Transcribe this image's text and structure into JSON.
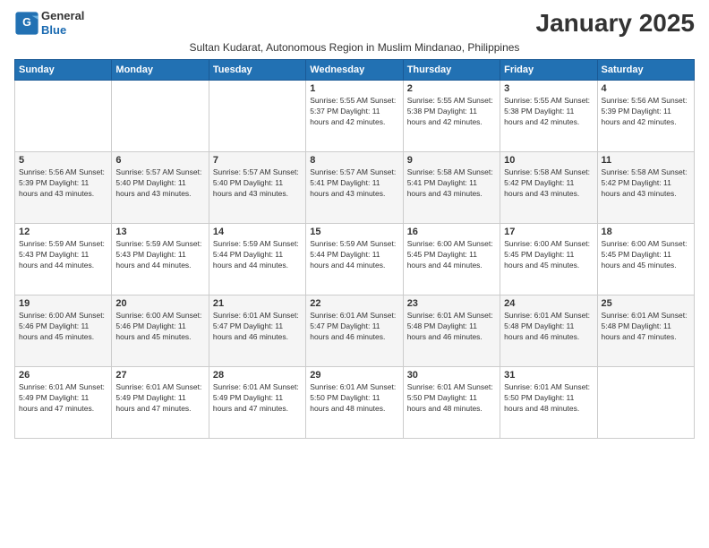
{
  "logo": {
    "line1": "General",
    "line2": "Blue"
  },
  "title": "January 2025",
  "subtitle": "Sultan Kudarat, Autonomous Region in Muslim Mindanao, Philippines",
  "days_header": [
    "Sunday",
    "Monday",
    "Tuesday",
    "Wednesday",
    "Thursday",
    "Friday",
    "Saturday"
  ],
  "weeks": [
    [
      {
        "num": "",
        "info": ""
      },
      {
        "num": "",
        "info": ""
      },
      {
        "num": "",
        "info": ""
      },
      {
        "num": "1",
        "info": "Sunrise: 5:55 AM\nSunset: 5:37 PM\nDaylight: 11 hours\nand 42 minutes."
      },
      {
        "num": "2",
        "info": "Sunrise: 5:55 AM\nSunset: 5:38 PM\nDaylight: 11 hours\nand 42 minutes."
      },
      {
        "num": "3",
        "info": "Sunrise: 5:55 AM\nSunset: 5:38 PM\nDaylight: 11 hours\nand 42 minutes."
      },
      {
        "num": "4",
        "info": "Sunrise: 5:56 AM\nSunset: 5:39 PM\nDaylight: 11 hours\nand 42 minutes."
      }
    ],
    [
      {
        "num": "5",
        "info": "Sunrise: 5:56 AM\nSunset: 5:39 PM\nDaylight: 11 hours\nand 43 minutes."
      },
      {
        "num": "6",
        "info": "Sunrise: 5:57 AM\nSunset: 5:40 PM\nDaylight: 11 hours\nand 43 minutes."
      },
      {
        "num": "7",
        "info": "Sunrise: 5:57 AM\nSunset: 5:40 PM\nDaylight: 11 hours\nand 43 minutes."
      },
      {
        "num": "8",
        "info": "Sunrise: 5:57 AM\nSunset: 5:41 PM\nDaylight: 11 hours\nand 43 minutes."
      },
      {
        "num": "9",
        "info": "Sunrise: 5:58 AM\nSunset: 5:41 PM\nDaylight: 11 hours\nand 43 minutes."
      },
      {
        "num": "10",
        "info": "Sunrise: 5:58 AM\nSunset: 5:42 PM\nDaylight: 11 hours\nand 43 minutes."
      },
      {
        "num": "11",
        "info": "Sunrise: 5:58 AM\nSunset: 5:42 PM\nDaylight: 11 hours\nand 43 minutes."
      }
    ],
    [
      {
        "num": "12",
        "info": "Sunrise: 5:59 AM\nSunset: 5:43 PM\nDaylight: 11 hours\nand 44 minutes."
      },
      {
        "num": "13",
        "info": "Sunrise: 5:59 AM\nSunset: 5:43 PM\nDaylight: 11 hours\nand 44 minutes."
      },
      {
        "num": "14",
        "info": "Sunrise: 5:59 AM\nSunset: 5:44 PM\nDaylight: 11 hours\nand 44 minutes."
      },
      {
        "num": "15",
        "info": "Sunrise: 5:59 AM\nSunset: 5:44 PM\nDaylight: 11 hours\nand 44 minutes."
      },
      {
        "num": "16",
        "info": "Sunrise: 6:00 AM\nSunset: 5:45 PM\nDaylight: 11 hours\nand 44 minutes."
      },
      {
        "num": "17",
        "info": "Sunrise: 6:00 AM\nSunset: 5:45 PM\nDaylight: 11 hours\nand 45 minutes."
      },
      {
        "num": "18",
        "info": "Sunrise: 6:00 AM\nSunset: 5:45 PM\nDaylight: 11 hours\nand 45 minutes."
      }
    ],
    [
      {
        "num": "19",
        "info": "Sunrise: 6:00 AM\nSunset: 5:46 PM\nDaylight: 11 hours\nand 45 minutes."
      },
      {
        "num": "20",
        "info": "Sunrise: 6:00 AM\nSunset: 5:46 PM\nDaylight: 11 hours\nand 45 minutes."
      },
      {
        "num": "21",
        "info": "Sunrise: 6:01 AM\nSunset: 5:47 PM\nDaylight: 11 hours\nand 46 minutes."
      },
      {
        "num": "22",
        "info": "Sunrise: 6:01 AM\nSunset: 5:47 PM\nDaylight: 11 hours\nand 46 minutes."
      },
      {
        "num": "23",
        "info": "Sunrise: 6:01 AM\nSunset: 5:48 PM\nDaylight: 11 hours\nand 46 minutes."
      },
      {
        "num": "24",
        "info": "Sunrise: 6:01 AM\nSunset: 5:48 PM\nDaylight: 11 hours\nand 46 minutes."
      },
      {
        "num": "25",
        "info": "Sunrise: 6:01 AM\nSunset: 5:48 PM\nDaylight: 11 hours\nand 47 minutes."
      }
    ],
    [
      {
        "num": "26",
        "info": "Sunrise: 6:01 AM\nSunset: 5:49 PM\nDaylight: 11 hours\nand 47 minutes."
      },
      {
        "num": "27",
        "info": "Sunrise: 6:01 AM\nSunset: 5:49 PM\nDaylight: 11 hours\nand 47 minutes."
      },
      {
        "num": "28",
        "info": "Sunrise: 6:01 AM\nSunset: 5:49 PM\nDaylight: 11 hours\nand 47 minutes."
      },
      {
        "num": "29",
        "info": "Sunrise: 6:01 AM\nSunset: 5:50 PM\nDaylight: 11 hours\nand 48 minutes."
      },
      {
        "num": "30",
        "info": "Sunrise: 6:01 AM\nSunset: 5:50 PM\nDaylight: 11 hours\nand 48 minutes."
      },
      {
        "num": "31",
        "info": "Sunrise: 6:01 AM\nSunset: 5:50 PM\nDaylight: 11 hours\nand 48 minutes."
      },
      {
        "num": "",
        "info": ""
      }
    ]
  ]
}
